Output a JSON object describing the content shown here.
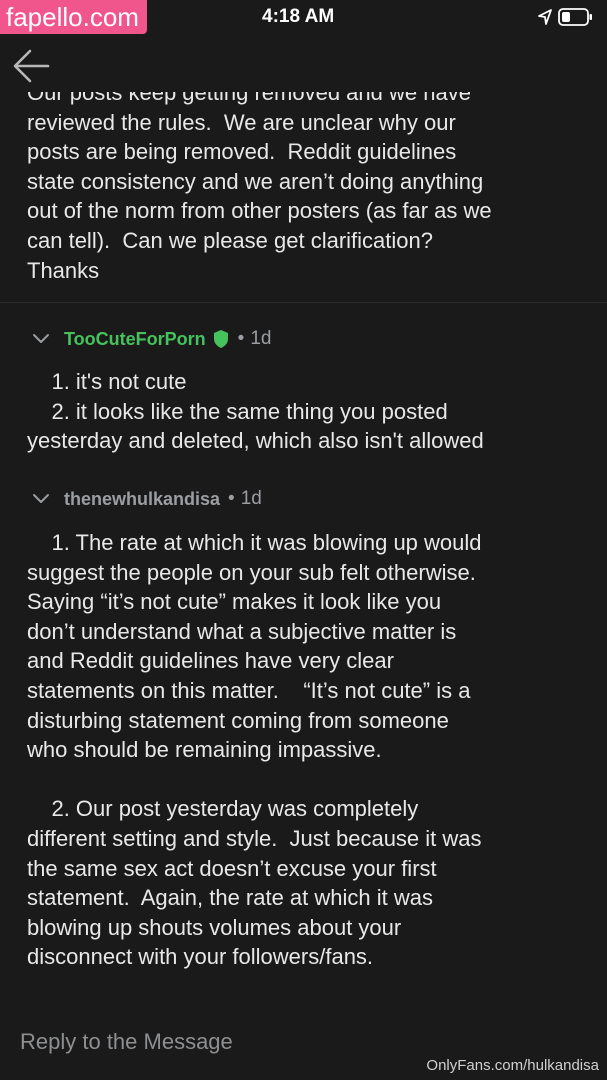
{
  "watermark": {
    "top_text": "fapello.com",
    "bottom_text": "OnlyFans.com/hulkandisa"
  },
  "status_bar": {
    "time": "4:18 AM",
    "icons": [
      "location-icon",
      "battery-icon"
    ]
  },
  "navigation": {
    "back_icon": "back-arrow-icon"
  },
  "message": {
    "body": "Our posts keep getting removed and we have\nreviewed the rules.  We are unclear why our\nposts are being removed.  Reddit guidelines\nstate consistency and we aren’t doing anything\nout of the norm from other posters (as far as we\ncan tell).  Can we please get clarification?\nThanks"
  },
  "comments": [
    {
      "author": "TooCuteForPorn",
      "is_moderator": true,
      "badge_icon": "shield-icon",
      "separator": "•",
      "age": "1d",
      "body": "    1. it's not cute\n    2. it looks like the same thing you posted\nyesterday and deleted, which also isn't allowed"
    },
    {
      "author": "thenewhulkandisa",
      "is_moderator": false,
      "separator": "•",
      "age": "1d",
      "body": "    1. The rate at which it was blowing up would\nsuggest the people on your sub felt otherwise.\nSaying “it’s not cute” makes it look like you\ndon’t understand what a subjective matter is\nand Reddit guidelines have very clear\nstatements on this matter.    “It’s not cute” is a\ndisturbing statement coming from someone\nwho should be remaining impassive.\n\n    2. Our post yesterday was completely\ndifferent setting and style.  Just because it was\nthe same sex act doesn’t excuse your first\nstatement.  Again, the rate at which it was\nblowing up shouts volumes about your\ndisconnect with your followers/fans."
    }
  ],
  "reply": {
    "placeholder": "Reply to the Message"
  },
  "colors": {
    "background": "#1a1a1b",
    "text": "#e8e8e8",
    "moderator_green": "#46c25c",
    "meta_gray": "#9a9ea1",
    "watermark_pink": "#f0558c"
  }
}
